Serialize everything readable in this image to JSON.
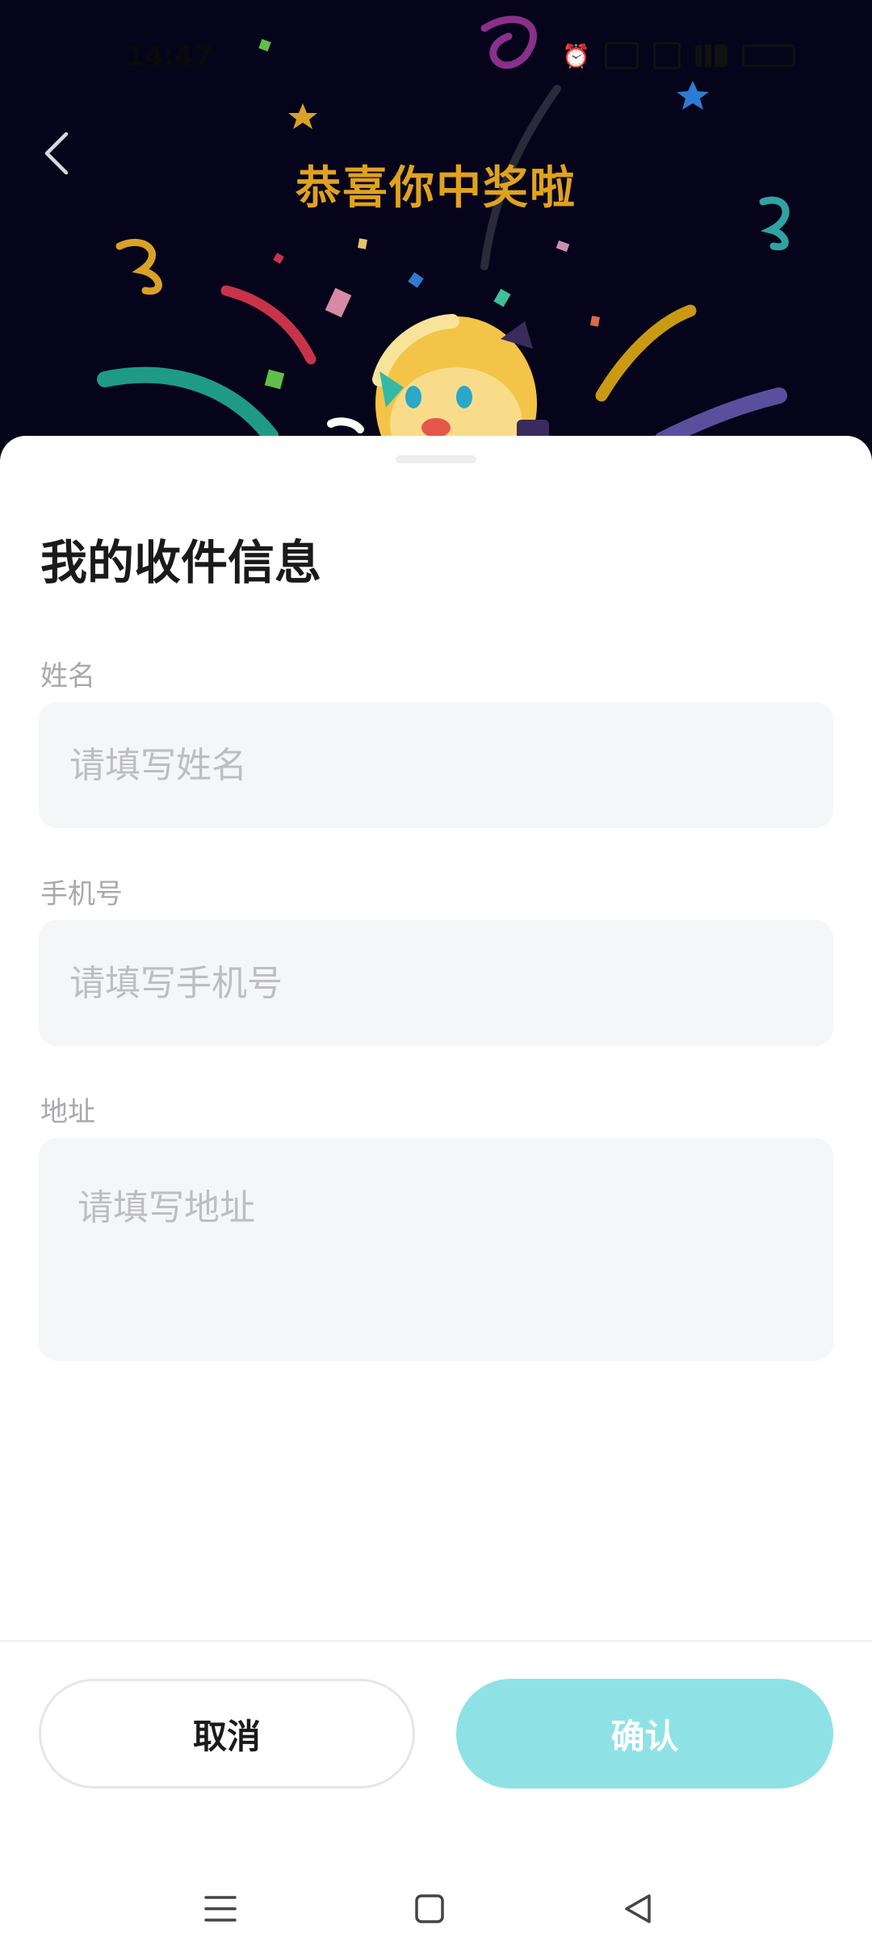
{
  "status_bar": {
    "time": "14:47",
    "icons": [
      "alarm-icon",
      "network-speed-icon",
      "wifi-icon",
      "signal-icon",
      "battery-icon"
    ]
  },
  "header": {
    "back_icon": "chevron-left-icon",
    "title": "恭喜你中奖啦"
  },
  "sheet": {
    "title": "我的收件信息",
    "fields": [
      {
        "label": "姓名",
        "placeholder": "请填写姓名",
        "value": ""
      },
      {
        "label": "手机号",
        "placeholder": "请填写手机号",
        "value": ""
      },
      {
        "label": "地址",
        "placeholder": "请填写地址",
        "value": ""
      }
    ],
    "cancel_label": "取消",
    "confirm_label": "确认"
  },
  "nav_bar": {
    "icons": [
      "menu-icon",
      "home-icon",
      "back-triangle-icon"
    ]
  },
  "colors": {
    "title_gold": "#e0a21e",
    "confirm_teal": "#8ee2e6",
    "field_bg": "#f5f6f8",
    "hero_bg": "#05041a"
  }
}
